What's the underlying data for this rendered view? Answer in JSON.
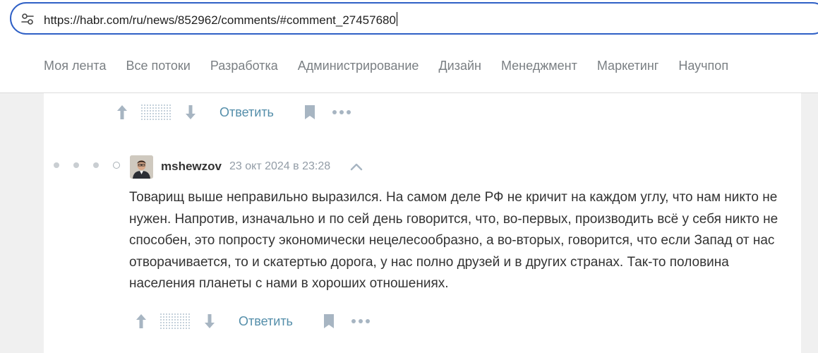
{
  "browser": {
    "url": "https://habr.com/ru/news/852962/comments/#comment_27457680"
  },
  "nav": {
    "items": [
      "Моя лента",
      "Все потоки",
      "Разработка",
      "Администрирование",
      "Дизайн",
      "Менеджмент",
      "Маркетинг",
      "Научпоп"
    ]
  },
  "comments": {
    "previous": {
      "reply_label": "Ответить"
    },
    "current": {
      "username": "mshewzov",
      "timestamp": "23 окт 2024 в 23:28",
      "text": "Товарищ выше неправильно выразился. На самом деле РФ не кричит на каждом углу, что нам никто не нужен. Напротив, изначально и по сей день говорится, что, во-первых, производить всё у себя никто не способен, это попросту экономически нецелесообразно, а во-вторых, говорится, что если Запад от нас отворачивается, то и скатертью дорога, у нас полно друзей и в других странах. Так-то половина населения планеты с нами в хороших отношениях.",
      "reply_label": "Ответить"
    }
  },
  "colors": {
    "accent": "#2f60c6",
    "link": "#548eaa",
    "icon": "#a7b5c2"
  }
}
